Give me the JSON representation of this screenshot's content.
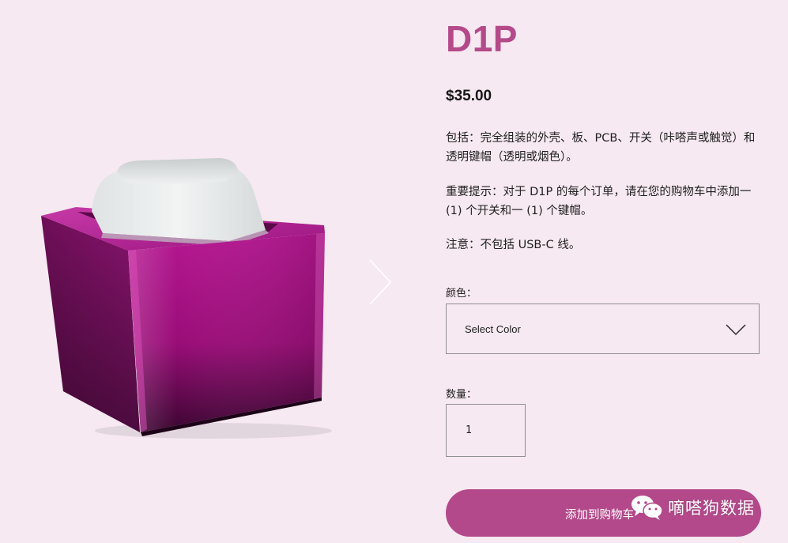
{
  "product": {
    "title": "D1P",
    "price": "$35.00",
    "description": [
      "包括：完全组装的外壳、板、PCB、开关（咔嗒声或触觉）和透明键帽（透明或烟色）。",
      "重要提示：对于 D1P 的每个订单，请在您的购物车中添加一 (1) 个开关和一 (1) 个键帽。",
      "注意：不包括 USB-C 线。"
    ],
    "image_icon": "magenta-keycap-cube-image"
  },
  "gallery": {
    "next_icon": "chevron-right-icon"
  },
  "color_field": {
    "label": "颜色：",
    "selected": "Select Color",
    "chevron_icon": "chevron-down-icon"
  },
  "quantity_field": {
    "label": "数量：",
    "value": "1"
  },
  "cart": {
    "add_label": "添加到购物车"
  },
  "watermark": {
    "text": "嘀嗒狗数据",
    "icon": "wechat-icon"
  },
  "colors": {
    "background": "#f6e9f1",
    "accent": "#b3498a",
    "title": "#b44a8a",
    "case_magenta": "#a0127d",
    "keycap": "#e9ecec"
  }
}
